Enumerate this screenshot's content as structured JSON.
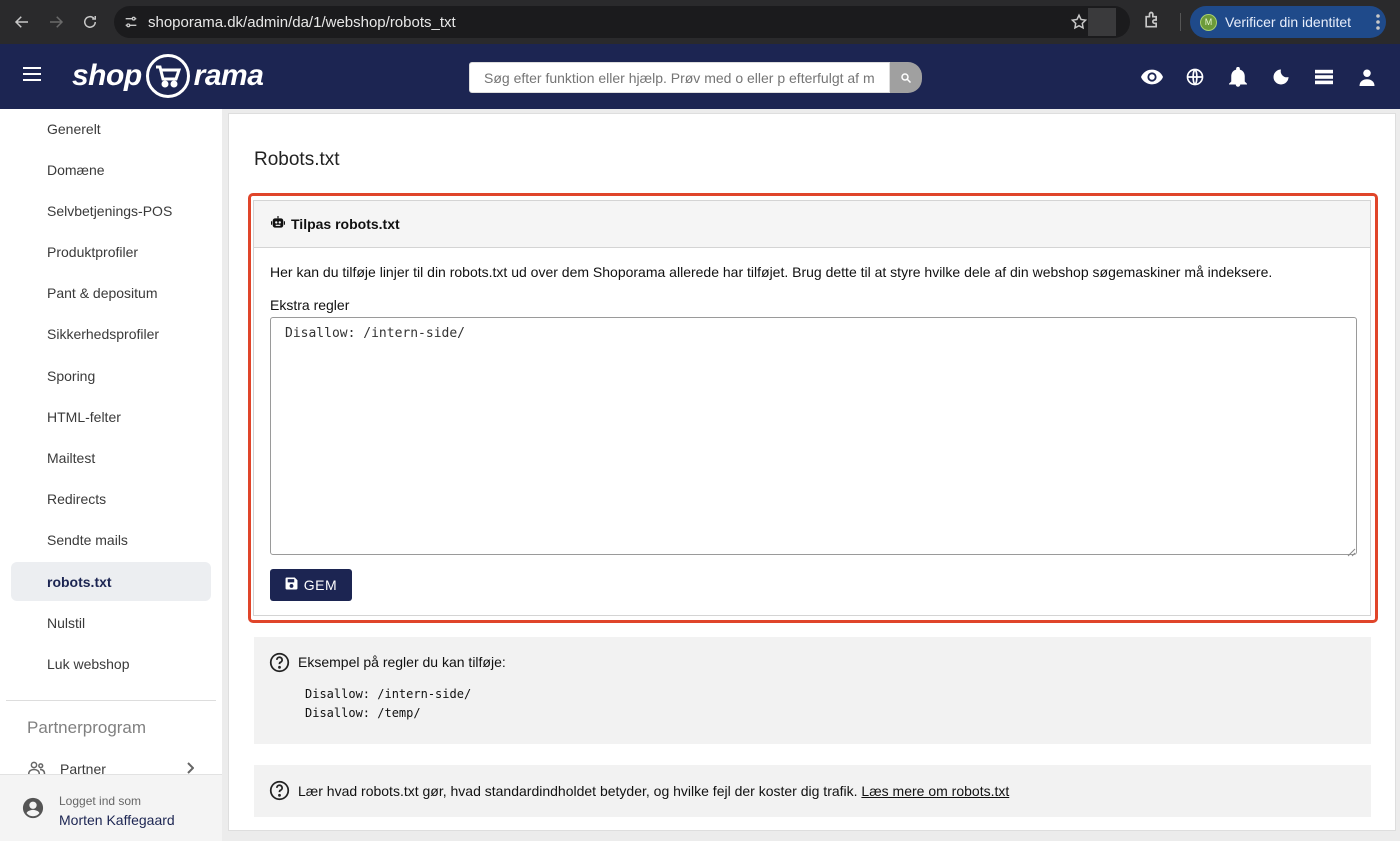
{
  "browser": {
    "url": "shoporama.dk/admin/da/1/webshop/robots_txt",
    "verify_label": "Verificer din identitet",
    "avatar_letter": "M"
  },
  "header": {
    "logo_left": "shop",
    "logo_right": "rama",
    "search_placeholder": "Søg efter funktion eller hjælp. Prøv med o eller p efterfulgt af mellemrum",
    "icons": [
      "eye-icon",
      "globe-icon",
      "bell-icon",
      "moon-icon",
      "stack-icon",
      "person-icon"
    ]
  },
  "sidebar": {
    "items": [
      {
        "label": "Generelt"
      },
      {
        "label": "Domæne"
      },
      {
        "label": "Selvbetjenings-POS"
      },
      {
        "label": "Produktprofiler"
      },
      {
        "label": "Pant & depositum"
      },
      {
        "label": "Sikkerhedsprofiler"
      },
      {
        "label": "Sporing"
      },
      {
        "label": "HTML-felter"
      },
      {
        "label": "Mailtest"
      },
      {
        "label": "Redirects"
      },
      {
        "label": "Sendte mails"
      },
      {
        "label": "robots.txt",
        "active": true
      },
      {
        "label": "Nulstil"
      },
      {
        "label": "Luk webshop"
      }
    ],
    "section_title": "Partnerprogram",
    "partner_label": "Partner",
    "user": {
      "logged_in_label": "Logget ind som",
      "name": "Morten Kaffegaard"
    }
  },
  "main": {
    "title": "Robots.txt",
    "card": {
      "heading": "Tilpas robots.txt",
      "description": "Her kan du tilføje linjer til din robots.txt ud over dem Shoporama allerede har tilføjet. Brug dette til at styre hvilke dele af din webshop søgemaskiner må indeksere.",
      "field_label": "Ekstra regler",
      "field_value": "Disallow: /intern-side/",
      "save_label": "GEM"
    },
    "example": {
      "text": "Eksempel på regler du kan tilføje:",
      "lines": [
        "Disallow: /intern-side/",
        "Disallow: /temp/"
      ]
    },
    "learn": {
      "text": "Lær hvad robots.txt gør, hvad standardindholdet betyder, og hvilke fejl der koster dig trafik.",
      "link": "Læs mere om robots.txt"
    }
  },
  "colors": {
    "brand": "#1c2552",
    "highlight": "#e0452a"
  }
}
